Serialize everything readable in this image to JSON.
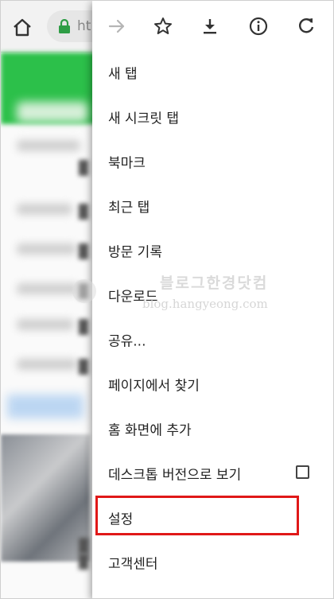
{
  "toolbar": {
    "url_text": "ht",
    "icons": [
      "home-icon",
      "lock-icon"
    ]
  },
  "menu": {
    "top_icons": [
      "forward-arrow-icon",
      "star-icon",
      "download-icon",
      "info-icon",
      "refresh-icon"
    ],
    "items": [
      {
        "label": "새 탭"
      },
      {
        "label": "새 시크릿 탭"
      },
      {
        "label": "북마크"
      },
      {
        "label": "최근 탭"
      },
      {
        "label": "방문 기록"
      },
      {
        "label": "다운로드"
      },
      {
        "label": "공유..."
      },
      {
        "label": "페이지에서 찾기"
      },
      {
        "label": "홈 화면에 추가"
      },
      {
        "label": "데스크톱 버전으로 보기",
        "checkbox": false
      },
      {
        "label": "설정",
        "highlighted": true
      },
      {
        "label": "고객센터"
      }
    ]
  },
  "watermark": {
    "title": "블로그한경닷컴",
    "subtitle": "blog.hangyeong.com"
  },
  "colors": {
    "highlight": "#e01818",
    "lock": "#2e9d45",
    "page_accent": "#2cc04a"
  }
}
